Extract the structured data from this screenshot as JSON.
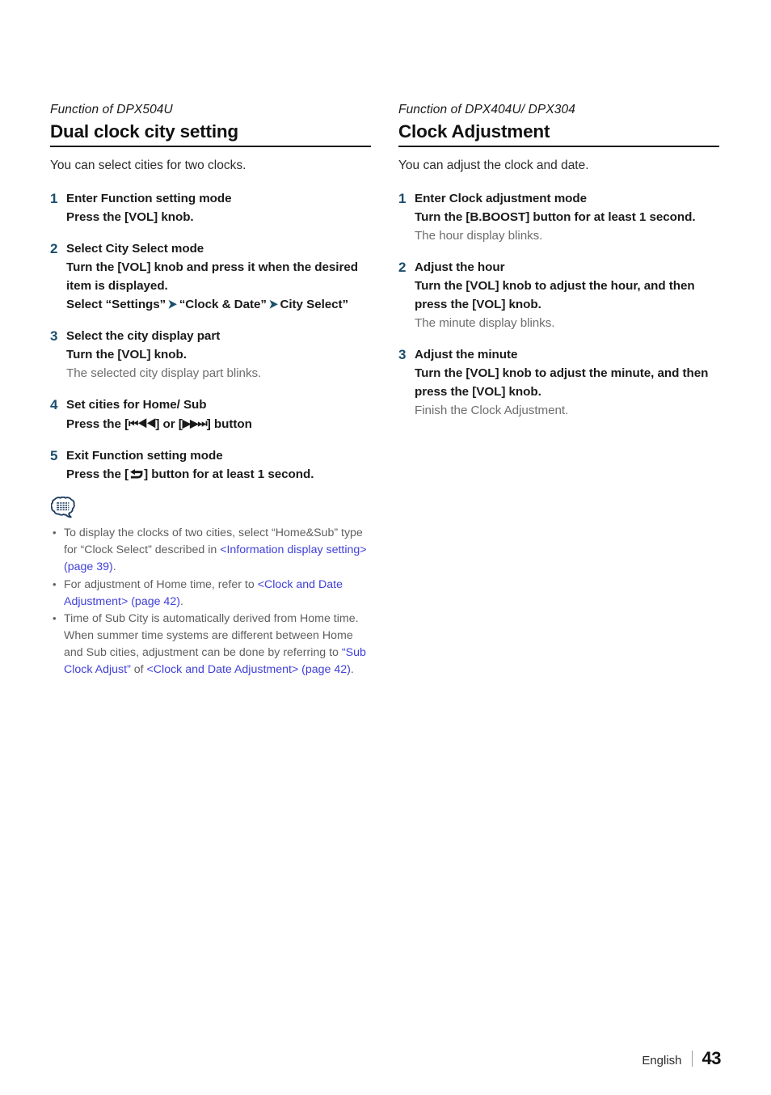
{
  "left_column": {
    "eyebrow": "Function of DPX504U",
    "section_title": "Dual clock city setting",
    "intro": "You can select cities for two clocks.",
    "steps": [
      {
        "num": "1",
        "title": "Enter Function setting mode",
        "action": "Press the [VOL] knob.",
        "result": ""
      },
      {
        "num": "2",
        "title": "Select City Select mode",
        "action": "Turn the [VOL] knob and press it when the desired item is displayed.",
        "menu_line_prefix": "Select “Settings”",
        "menu_line_mid": "“Clock & Date”",
        "menu_line_end": "City Select”",
        "result": ""
      },
      {
        "num": "3",
        "title": "Select the city display part",
        "action": "Turn the [VOL] knob.",
        "result": "The selected city display part blinks."
      },
      {
        "num": "4",
        "title": "Set cities for Home/ Sub",
        "action_prefix": "Press the [",
        "action_glyph_prev": "⏮◀◀",
        "action_mid": "] or [",
        "action_glyph_next": "▶▶⏭",
        "action_suffix": "] button",
        "result": ""
      },
      {
        "num": "5",
        "title": "Exit Function setting mode",
        "action_prefix": "Press the [",
        "action_suffix": "] button for at least 1 second.",
        "result": ""
      }
    ],
    "note": {
      "icon_name": "note-speech-bubble-icon",
      "bullets": [
        {
          "segments": [
            {
              "text": "To display the clocks of two cities, select “Home&Sub” type for “Clock Select” described in ",
              "link": false
            },
            {
              "text": "<Information display setting> (page 39)",
              "link": true
            },
            {
              "text": ".",
              "link": false
            }
          ]
        },
        {
          "segments": [
            {
              "text": "For adjustment of Home time, refer to ",
              "link": false
            },
            {
              "text": "<Clock and Date Adjustment> (page 42)",
              "link": true
            },
            {
              "text": ".",
              "link": false
            }
          ]
        },
        {
          "segments": [
            {
              "text": "Time of Sub City is automatically derived from Home time. When summer time systems are different between Home and Sub cities, adjustment can be done by referring to ",
              "link": false
            },
            {
              "text": "“Sub Clock Adjust”",
              "link": true
            },
            {
              "text": " of ",
              "link": false
            },
            {
              "text": "<Clock and Date Adjustment> (page 42)",
              "link": true
            },
            {
              "text": ".",
              "link": false
            }
          ]
        }
      ]
    }
  },
  "right_column": {
    "eyebrow": "Function of DPX404U/ DPX304",
    "section_title": "Clock Adjustment",
    "intro": "You can adjust the clock and date.",
    "steps": [
      {
        "num": "1",
        "title": "Enter Clock adjustment mode",
        "action": "Turn the [B.BOOST] button for at least 1 second.",
        "result": "The hour display blinks."
      },
      {
        "num": "2",
        "title": "Adjust the hour",
        "action": "Turn the [VOL] knob to adjust the hour, and then press the [VOL] knob.",
        "result": "The minute display blinks."
      },
      {
        "num": "3",
        "title": "Adjust the minute",
        "action": "Turn the [VOL] knob to adjust the minute, and then press the [VOL] knob.",
        "result": "Finish the Clock Adjustment."
      }
    ]
  },
  "footer": {
    "language": "English",
    "page_number": "43"
  },
  "colors": {
    "step_number": "#1a4e6e",
    "link": "#4040d8",
    "result_text": "#6e6e6e",
    "body_text": "#1a1a1a",
    "note_text": "#5f5f5f"
  }
}
